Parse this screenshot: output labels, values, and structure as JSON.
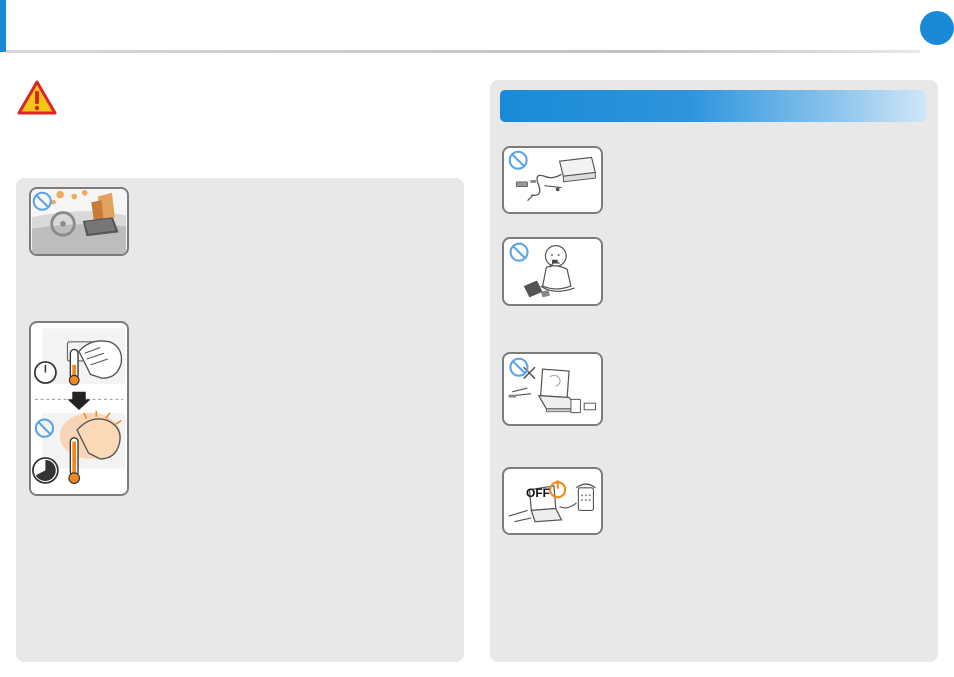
{
  "header": {
    "accent_color": "#1a8ad8",
    "chapter_marker_icon": "blue-circle-icon"
  },
  "warning": {
    "icon": "warning-triangle-icon",
    "colors": {
      "fill": "#f5c518",
      "border": "#d9262b"
    }
  },
  "left_panel": {
    "illustrations": [
      {
        "icon": "car-dashboard-laptop-prohibited-icon"
      },
      {
        "icon": "laptop-palm-rest-heat-icon"
      }
    ]
  },
  "right_panel": {
    "bar_color": "#1a8ad8",
    "illustrations": [
      {
        "icon": "power-adapter-cable-prohibited-icon"
      },
      {
        "icon": "child-chewing-battery-prohibited-icon"
      },
      {
        "icon": "laptop-disassembly-prohibited-icon"
      },
      {
        "icon": "power-off-phone-line-icon",
        "label": "OFF"
      }
    ]
  }
}
